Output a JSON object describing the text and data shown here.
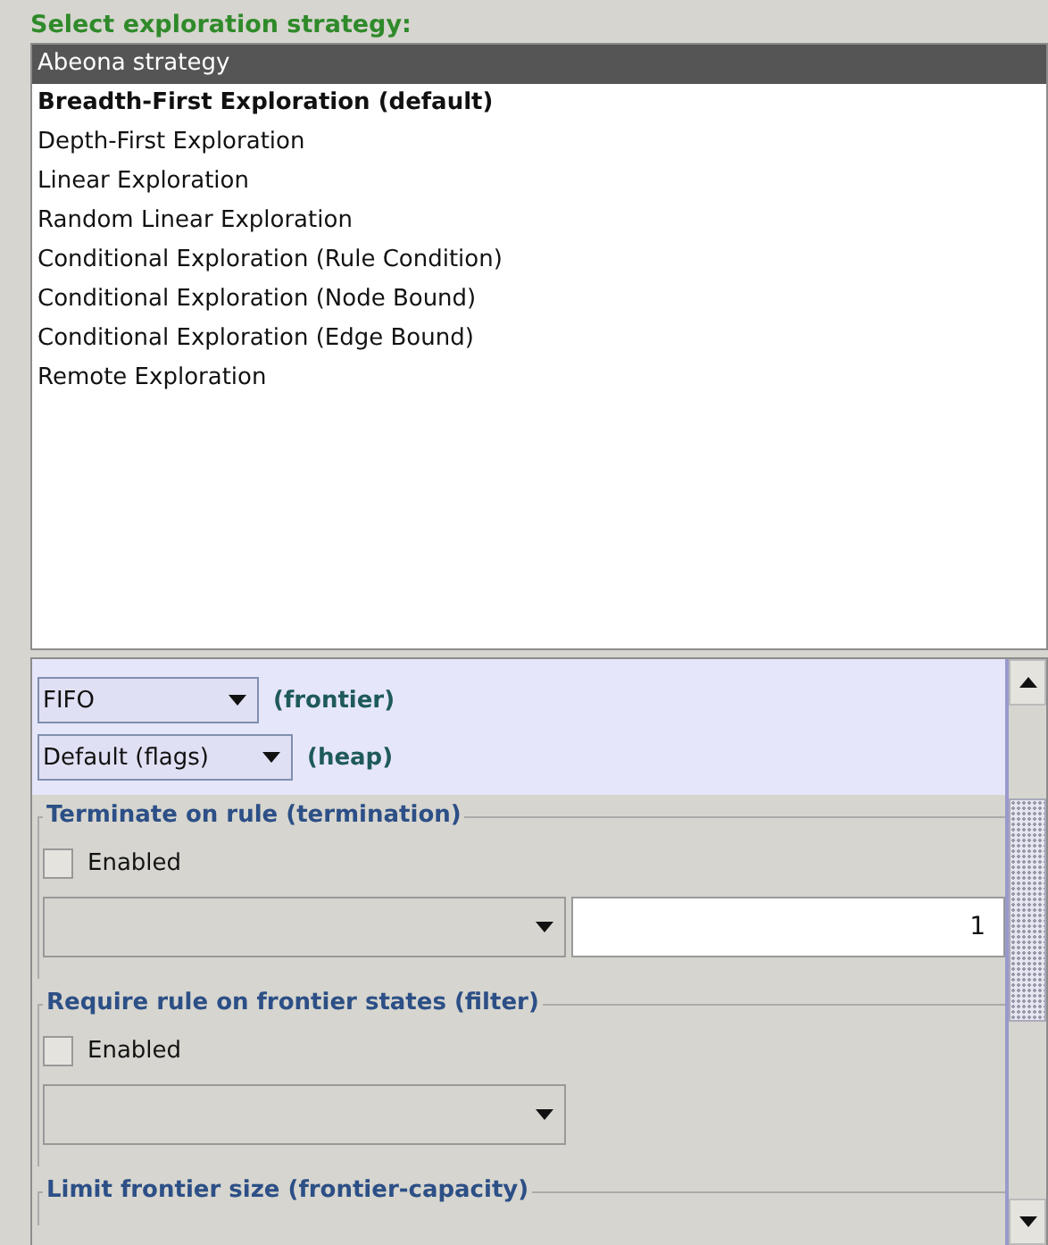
{
  "heading": "Select exploration strategy:",
  "strategies": [
    {
      "label": "Abeona strategy",
      "selected": true,
      "emphasized": false
    },
    {
      "label": "Breadth-First Exploration (default)",
      "selected": false,
      "emphasized": true
    },
    {
      "label": "Depth-First Exploration",
      "selected": false,
      "emphasized": false
    },
    {
      "label": "Linear Exploration",
      "selected": false,
      "emphasized": false
    },
    {
      "label": "Random Linear Exploration",
      "selected": false,
      "emphasized": false
    },
    {
      "label": "Conditional Exploration (Rule Condition)",
      "selected": false,
      "emphasized": false
    },
    {
      "label": "Conditional Exploration (Node Bound)",
      "selected": false,
      "emphasized": false
    },
    {
      "label": "Conditional Exploration (Edge Bound)",
      "selected": false,
      "emphasized": false
    },
    {
      "label": "Remote Exploration",
      "selected": false,
      "emphasized": false
    }
  ],
  "options": [
    {
      "value": "FIFO",
      "label": "(frontier)"
    },
    {
      "value": "Default (flags)",
      "label": "(heap)"
    }
  ],
  "sections": [
    {
      "title": "Terminate on rule (termination)",
      "checkbox": {
        "label": "Enabled",
        "checked": false
      },
      "number": "1"
    },
    {
      "title": "Require rule on frontier states (filter)",
      "checkbox": {
        "label": "Enabled",
        "checked": false
      }
    },
    {
      "title": "Limit frontier size (frontier-capacity)"
    }
  ]
}
